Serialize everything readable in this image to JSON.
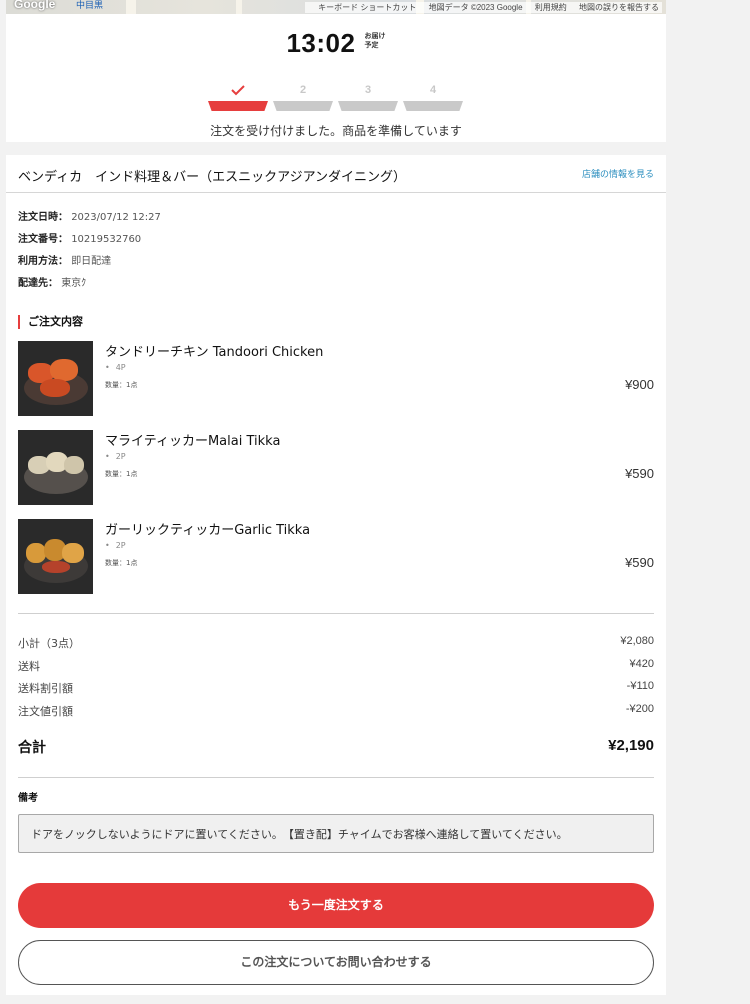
{
  "map": {
    "logo": "Google",
    "station": "中目黒",
    "credits": [
      "キーボード ショートカット",
      "地図データ ©2023 Google",
      "利用規約",
      "地図の誤りを報告する"
    ]
  },
  "status": {
    "time": "13:02",
    "time_label_1": "お届け",
    "time_label_2": "予定",
    "steps": [
      "",
      "2",
      "3",
      "4"
    ],
    "active_step": 1,
    "message": "注文を受け付けました。商品を準備しています",
    "accent_color": "#e63e3e"
  },
  "shop": {
    "name": "ベンディカ　インド料理＆バー（エスニックアジアンダイニング）",
    "info_link": "店舗の情報を見る"
  },
  "order_meta": [
    {
      "key": "注文日時：",
      "value": "2023/07/12 12:27"
    },
    {
      "key": "注文番号：",
      "value": "10219532760"
    },
    {
      "key": "利用方法：",
      "value": "即日配達"
    },
    {
      "key": "配達先：",
      "value": "東京ｸ"
    }
  ],
  "section_title": "ご注文内容",
  "items": [
    {
      "name": "タンドリーチキン Tandoori Chicken",
      "option": "4P",
      "qty": "数量：1点",
      "price": "¥900",
      "icon": "tandoori-chicken-photo"
    },
    {
      "name": "マライティッカーMalai Tikka",
      "option": "2P",
      "qty": "数量：1点",
      "price": "¥590",
      "icon": "malai-tikka-photo"
    },
    {
      "name": "ガーリックティッカーGarlic Tikka",
      "option": "2P",
      "qty": "数量：1点",
      "price": "¥590",
      "icon": "garlic-tikka-photo"
    }
  ],
  "totals": [
    {
      "label": "小計（3点）",
      "value": "¥2,080"
    },
    {
      "label": "送料",
      "value": "¥420"
    },
    {
      "label": "送料割引額",
      "value": "-¥110"
    },
    {
      "label": "注文値引額",
      "value": "-¥200"
    }
  ],
  "grand_total": {
    "label": "合計",
    "value": "¥2,190"
  },
  "notes": {
    "label": "備考",
    "text": "ドアをノックしないようにドアに置いてください。　【置き配】チャイムでお客様へ連絡して置いてください。"
  },
  "buttons": {
    "reorder": "もう一度注文する",
    "inquiry": "この注文についてお問い合わせする"
  }
}
